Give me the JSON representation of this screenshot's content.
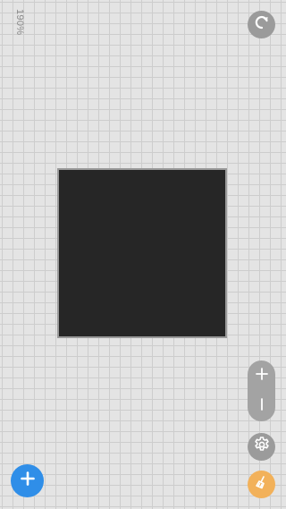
{
  "zoom": {
    "label": "190%"
  },
  "canvas": {
    "square_color": "#262626",
    "border_color": "#999999"
  },
  "toolbar": {
    "undo_icon": "undo-arrow-icon",
    "zoom_in_icon": "plus-icon",
    "zoom_out_icon": "minus-icon",
    "settings_icon": "gear-icon",
    "clear_icon": "broom-icon",
    "add_icon": "plus-icon"
  },
  "colors": {
    "background": "#e4e4e4",
    "grid_line": "#cdcdcd",
    "gray_button": "#9b9b9b",
    "accent_blue": "#2f8ee8",
    "accent_orange": "#f2b15a"
  }
}
